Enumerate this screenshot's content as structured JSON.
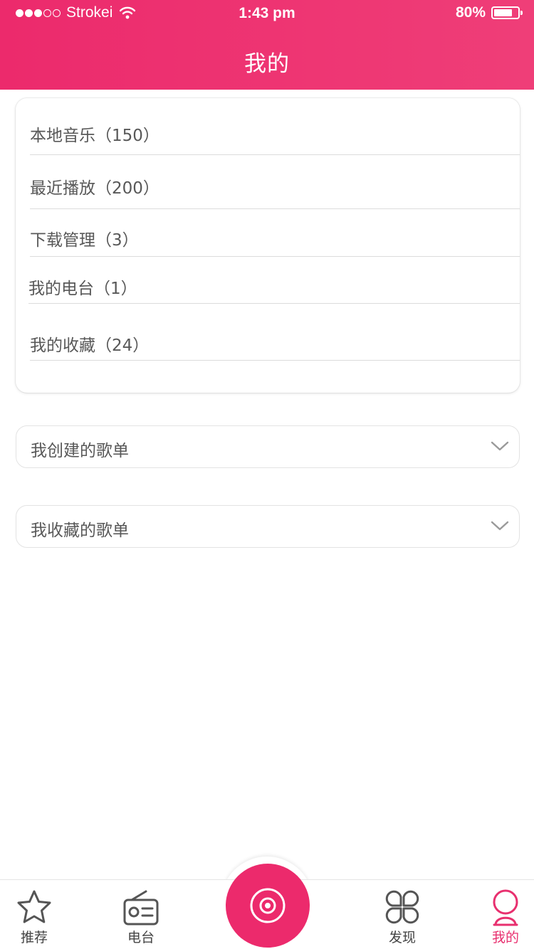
{
  "status_bar": {
    "carrier": "Strokei",
    "time": "1:43 pm",
    "battery_percent": "80%",
    "battery_level": 0.8,
    "signal_bars": 3
  },
  "header": {
    "title": "我的"
  },
  "library": {
    "items": [
      {
        "label": "本地音乐（150）"
      },
      {
        "label": "最近播放（200）"
      },
      {
        "label": "下载管理（3）"
      },
      {
        "label": "我的电台（1）"
      },
      {
        "label": "我的收藏（24）"
      }
    ]
  },
  "playlists": {
    "created_label": "我创建的歌单",
    "collected_label": "我收藏的歌单"
  },
  "tabbar": {
    "tabs": [
      {
        "label": "推荐",
        "icon": "star-icon"
      },
      {
        "label": "电台",
        "icon": "radio-icon"
      },
      {
        "label": "发现",
        "icon": "clover-icon"
      },
      {
        "label": "我的",
        "icon": "person-icon"
      }
    ],
    "center_icon": "disc-icon",
    "active_tab": "我的"
  },
  "colors": {
    "accent": "#ec2a6c",
    "text": "#585858",
    "divider": "#dcdcdc"
  }
}
